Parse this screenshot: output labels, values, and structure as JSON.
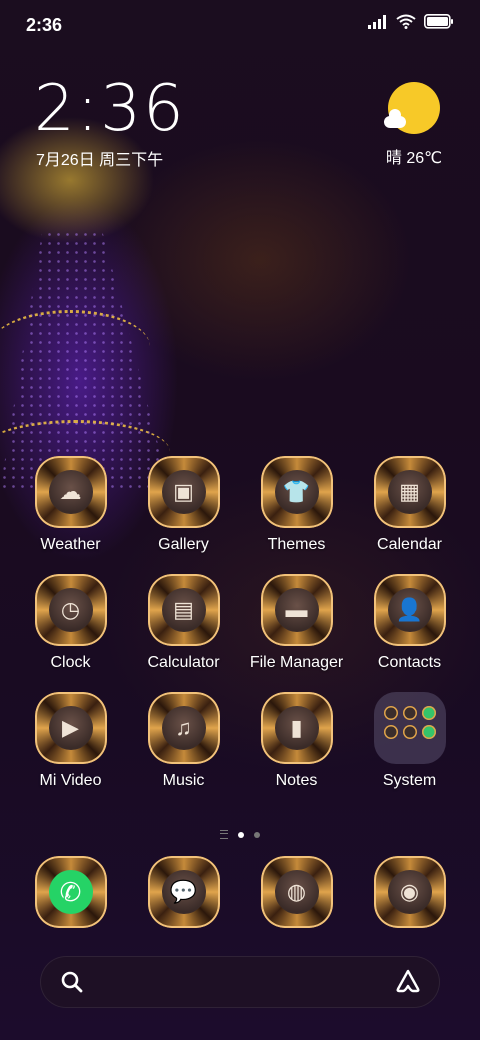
{
  "status_bar": {
    "time": "2:36",
    "icons": [
      "signal-icon",
      "wifi-icon",
      "battery-icon"
    ]
  },
  "clock_widget": {
    "time": "2:36",
    "date": "7月26日 周三下午"
  },
  "weather_widget": {
    "icon": "sun-cloud-icon",
    "text": "晴 26℃"
  },
  "apps": [
    {
      "label": "Weather",
      "icon": "weather-icon",
      "glyph": "☁"
    },
    {
      "label": "Gallery",
      "icon": "gallery-icon",
      "glyph": "▣"
    },
    {
      "label": "Themes",
      "icon": "themes-icon",
      "glyph": "👕"
    },
    {
      "label": "Calendar",
      "icon": "calendar-icon",
      "glyph": "▦"
    },
    {
      "label": "Clock",
      "icon": "clock-icon",
      "glyph": "◷"
    },
    {
      "label": "Calculator",
      "icon": "calculator-icon",
      "glyph": "▤"
    },
    {
      "label": "File Manager",
      "icon": "folder-icon",
      "glyph": "▬"
    },
    {
      "label": "Contacts",
      "icon": "contacts-icon",
      "glyph": "👤"
    },
    {
      "label": "Mi Video",
      "icon": "play-icon",
      "glyph": "▶"
    },
    {
      "label": "Music",
      "icon": "music-icon",
      "glyph": "♫"
    },
    {
      "label": "Notes",
      "icon": "notes-icon",
      "glyph": "▮"
    },
    {
      "label": "System",
      "icon": "system-folder-icon",
      "glyph": ""
    }
  ],
  "pager": {
    "pages": 2,
    "active": 0
  },
  "dock": [
    {
      "icon": "phone-icon",
      "glyph": "✆"
    },
    {
      "icon": "messages-icon",
      "glyph": "💬"
    },
    {
      "icon": "browser-icon",
      "glyph": "◍"
    },
    {
      "icon": "camera-icon",
      "glyph": "◉"
    }
  ],
  "search_bar": {
    "left_icon": "search-icon",
    "right_icon": "assistant-icon"
  }
}
